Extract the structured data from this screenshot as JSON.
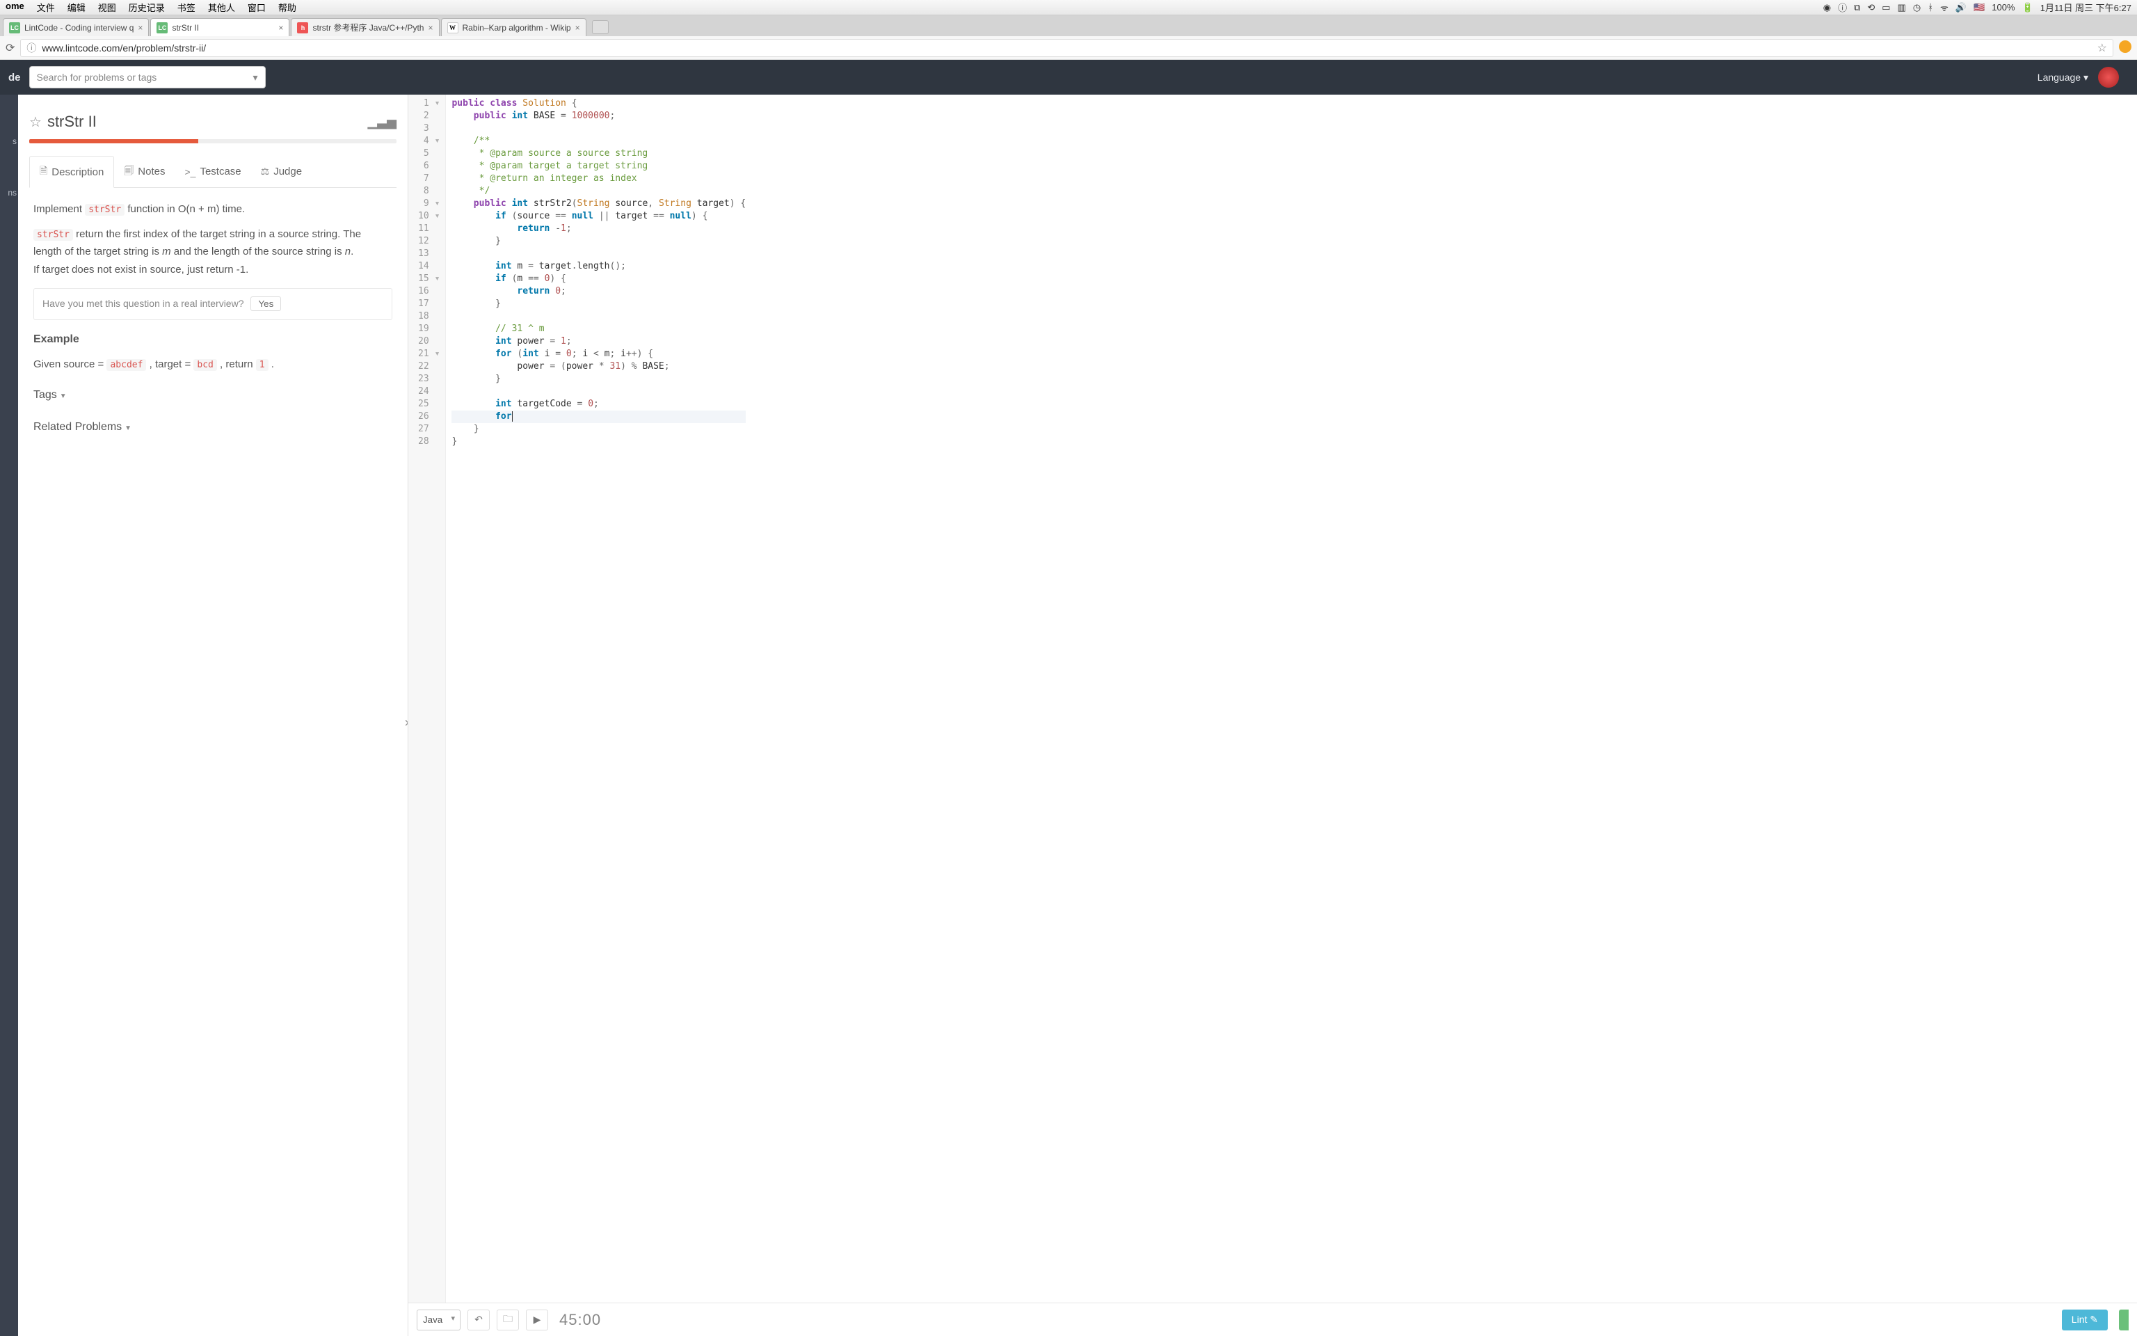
{
  "menubar": {
    "app": "ome",
    "items": [
      "文件",
      "编辑",
      "视图",
      "历史记录",
      "书签",
      "其他人",
      "窗口",
      "帮助"
    ],
    "battery": "100%",
    "datetime": "1月11日 周三 下午6:27"
  },
  "tabs": [
    {
      "favicon": "LC",
      "title": "LintCode - Coding interview q",
      "active": false
    },
    {
      "favicon": "LC",
      "title": "strStr II",
      "active": true
    },
    {
      "favicon": "h",
      "title": "strstr 参考程序 Java/C++/Pyth",
      "active": false
    },
    {
      "favicon": "W",
      "title": "Rabin–Karp algorithm - Wikip",
      "active": false
    }
  ],
  "url": "www.lintcode.com/en/problem/strstr-ii/",
  "header": {
    "brand": "de",
    "search_placeholder": "Search for problems or tags",
    "language_label": "Language"
  },
  "left_nav_hints": [
    "",
    "",
    "s",
    "ns"
  ],
  "problem": {
    "title": "strStr II",
    "ptabs": {
      "description": "Description",
      "notes": "Notes",
      "testcase": "Testcase",
      "judge": "Judge"
    },
    "desc": {
      "line1_pre": "Implement ",
      "code1": "strStr",
      "line1_post": " function in O(n + m) time.",
      "line2_code": "strStr",
      "line2_a": " return the first index of the target string in a source string. The length of the target string is ",
      "line2_m": "m",
      "line2_b": " and the length of the source string is ",
      "line2_n": "n",
      "line2_c": ".",
      "line3": "If target does not exist in source, just return -1."
    },
    "interview_q": "Have you met this question in a real interview?",
    "interview_yes": "Yes",
    "example_h": "Example",
    "example": {
      "pre": "Given source = ",
      "src": "abcdef",
      "mid": " , target = ",
      "tgt": "bcd",
      "ret": " , return ",
      "val": "1",
      "end": " ."
    },
    "tags_h": "Tags",
    "related_h": "Related Problems"
  },
  "code": {
    "lines": [
      {
        "n": "1",
        "fold": "▾",
        "tokens": [
          [
            "kw",
            "public"
          ],
          [
            "sp",
            " "
          ],
          [
            "kw",
            "class"
          ],
          [
            "sp",
            " "
          ],
          [
            "cls",
            "Solution"
          ],
          [
            "sp",
            " "
          ],
          [
            "op",
            "{"
          ]
        ]
      },
      {
        "n": "2",
        "tokens": [
          [
            "sp",
            "    "
          ],
          [
            "kw",
            "public"
          ],
          [
            "sp",
            " "
          ],
          [
            "type",
            "int"
          ],
          [
            "sp",
            " "
          ],
          [
            "fn",
            "BASE"
          ],
          [
            "sp",
            " "
          ],
          [
            "op",
            "="
          ],
          [
            "sp",
            " "
          ],
          [
            "num",
            "1000000"
          ],
          [
            "op",
            ";"
          ]
        ]
      },
      {
        "n": "3",
        "tokens": []
      },
      {
        "n": "4",
        "fold": "▾",
        "tokens": [
          [
            "sp",
            "    "
          ],
          [
            "com",
            "/**"
          ]
        ]
      },
      {
        "n": "5",
        "tokens": [
          [
            "sp",
            "     "
          ],
          [
            "com",
            "* @param source a source string"
          ]
        ]
      },
      {
        "n": "6",
        "tokens": [
          [
            "sp",
            "     "
          ],
          [
            "com",
            "* @param target a target string"
          ]
        ]
      },
      {
        "n": "7",
        "tokens": [
          [
            "sp",
            "     "
          ],
          [
            "com",
            "* @return an integer as index"
          ]
        ]
      },
      {
        "n": "8",
        "tokens": [
          [
            "sp",
            "     "
          ],
          [
            "com",
            "*/"
          ]
        ]
      },
      {
        "n": "9",
        "fold": "▾",
        "tokens": [
          [
            "sp",
            "    "
          ],
          [
            "kw",
            "public"
          ],
          [
            "sp",
            " "
          ],
          [
            "type",
            "int"
          ],
          [
            "sp",
            " "
          ],
          [
            "fn",
            "strStr2"
          ],
          [
            "op",
            "("
          ],
          [
            "cls",
            "String"
          ],
          [
            "sp",
            " "
          ],
          [
            "fn",
            "source"
          ],
          [
            "op",
            ","
          ],
          [
            "sp",
            " "
          ],
          [
            "cls",
            "String"
          ],
          [
            "sp",
            " "
          ],
          [
            "fn",
            "target"
          ],
          [
            "op",
            ")"
          ],
          [
            "sp",
            " "
          ],
          [
            "op",
            "{"
          ]
        ]
      },
      {
        "n": "10",
        "fold": "▾",
        "tokens": [
          [
            "sp",
            "        "
          ],
          [
            "kw2",
            "if"
          ],
          [
            "sp",
            " "
          ],
          [
            "op",
            "("
          ],
          [
            "fn",
            "source"
          ],
          [
            "sp",
            " "
          ],
          [
            "op",
            "=="
          ],
          [
            "sp",
            " "
          ],
          [
            "kw2",
            "null"
          ],
          [
            "sp",
            " "
          ],
          [
            "op",
            "||"
          ],
          [
            "sp",
            " "
          ],
          [
            "fn",
            "target"
          ],
          [
            "sp",
            " "
          ],
          [
            "op",
            "=="
          ],
          [
            "sp",
            " "
          ],
          [
            "kw2",
            "null"
          ],
          [
            "op",
            ")"
          ],
          [
            "sp",
            " "
          ],
          [
            "op",
            "{"
          ]
        ]
      },
      {
        "n": "11",
        "tokens": [
          [
            "sp",
            "            "
          ],
          [
            "kw2",
            "return"
          ],
          [
            "sp",
            " "
          ],
          [
            "op",
            "-"
          ],
          [
            "num",
            "1"
          ],
          [
            "op",
            ";"
          ]
        ]
      },
      {
        "n": "12",
        "tokens": [
          [
            "sp",
            "        "
          ],
          [
            "op",
            "}"
          ]
        ]
      },
      {
        "n": "13",
        "tokens": []
      },
      {
        "n": "14",
        "tokens": [
          [
            "sp",
            "        "
          ],
          [
            "type",
            "int"
          ],
          [
            "sp",
            " "
          ],
          [
            "fn",
            "m"
          ],
          [
            "sp",
            " "
          ],
          [
            "op",
            "="
          ],
          [
            "sp",
            " "
          ],
          [
            "fn",
            "target"
          ],
          [
            "op",
            "."
          ],
          [
            "fn",
            "length"
          ],
          [
            "op",
            "();"
          ]
        ]
      },
      {
        "n": "15",
        "fold": "▾",
        "tokens": [
          [
            "sp",
            "        "
          ],
          [
            "kw2",
            "if"
          ],
          [
            "sp",
            " "
          ],
          [
            "op",
            "("
          ],
          [
            "fn",
            "m"
          ],
          [
            "sp",
            " "
          ],
          [
            "op",
            "=="
          ],
          [
            "sp",
            " "
          ],
          [
            "num",
            "0"
          ],
          [
            "op",
            ")"
          ],
          [
            "sp",
            " "
          ],
          [
            "op",
            "{"
          ]
        ]
      },
      {
        "n": "16",
        "tokens": [
          [
            "sp",
            "            "
          ],
          [
            "kw2",
            "return"
          ],
          [
            "sp",
            " "
          ],
          [
            "num",
            "0"
          ],
          [
            "op",
            ";"
          ]
        ]
      },
      {
        "n": "17",
        "tokens": [
          [
            "sp",
            "        "
          ],
          [
            "op",
            "}"
          ]
        ]
      },
      {
        "n": "18",
        "tokens": []
      },
      {
        "n": "19",
        "tokens": [
          [
            "sp",
            "        "
          ],
          [
            "com",
            "// 31 ^ m"
          ]
        ]
      },
      {
        "n": "20",
        "tokens": [
          [
            "sp",
            "        "
          ],
          [
            "type",
            "int"
          ],
          [
            "sp",
            " "
          ],
          [
            "fn",
            "power"
          ],
          [
            "sp",
            " "
          ],
          [
            "op",
            "="
          ],
          [
            "sp",
            " "
          ],
          [
            "num",
            "1"
          ],
          [
            "op",
            ";"
          ]
        ]
      },
      {
        "n": "21",
        "fold": "▾",
        "tokens": [
          [
            "sp",
            "        "
          ],
          [
            "kw2",
            "for"
          ],
          [
            "sp",
            " "
          ],
          [
            "op",
            "("
          ],
          [
            "type",
            "int"
          ],
          [
            "sp",
            " "
          ],
          [
            "fn",
            "i"
          ],
          [
            "sp",
            " "
          ],
          [
            "op",
            "="
          ],
          [
            "sp",
            " "
          ],
          [
            "num",
            "0"
          ],
          [
            "op",
            ";"
          ],
          [
            "sp",
            " "
          ],
          [
            "fn",
            "i"
          ],
          [
            "sp",
            " "
          ],
          [
            "op",
            "<"
          ],
          [
            "sp",
            " "
          ],
          [
            "fn",
            "m"
          ],
          [
            "op",
            ";"
          ],
          [
            "sp",
            " "
          ],
          [
            "fn",
            "i"
          ],
          [
            "op",
            "++)"
          ],
          [
            "sp",
            " "
          ],
          [
            "op",
            "{"
          ]
        ]
      },
      {
        "n": "22",
        "tokens": [
          [
            "sp",
            "            "
          ],
          [
            "fn",
            "power"
          ],
          [
            "sp",
            " "
          ],
          [
            "op",
            "="
          ],
          [
            "sp",
            " "
          ],
          [
            "op",
            "("
          ],
          [
            "fn",
            "power"
          ],
          [
            "sp",
            " "
          ],
          [
            "op",
            "*"
          ],
          [
            "sp",
            " "
          ],
          [
            "num",
            "31"
          ],
          [
            "op",
            ")"
          ],
          [
            "sp",
            " "
          ],
          [
            "op",
            "%"
          ],
          [
            "sp",
            " "
          ],
          [
            "fn",
            "BASE"
          ],
          [
            "op",
            ";"
          ]
        ]
      },
      {
        "n": "23",
        "tokens": [
          [
            "sp",
            "        "
          ],
          [
            "op",
            "}"
          ]
        ]
      },
      {
        "n": "24",
        "tokens": []
      },
      {
        "n": "25",
        "tokens": [
          [
            "sp",
            "        "
          ],
          [
            "type",
            "int"
          ],
          [
            "sp",
            " "
          ],
          [
            "fn",
            "targetCode"
          ],
          [
            "sp",
            " "
          ],
          [
            "op",
            "="
          ],
          [
            "sp",
            " "
          ],
          [
            "num",
            "0"
          ],
          [
            "op",
            ";"
          ]
        ]
      },
      {
        "n": "26",
        "hl": true,
        "cursor": true,
        "tokens": [
          [
            "sp",
            "        "
          ],
          [
            "kw2",
            "for"
          ]
        ]
      },
      {
        "n": "27",
        "tokens": [
          [
            "sp",
            "    "
          ],
          [
            "op",
            "}"
          ]
        ]
      },
      {
        "n": "28",
        "tokens": [
          [
            "op",
            "}"
          ]
        ]
      }
    ]
  },
  "footer": {
    "language": "Java",
    "timer": "45:00",
    "lint_label": "Lint ✎"
  }
}
